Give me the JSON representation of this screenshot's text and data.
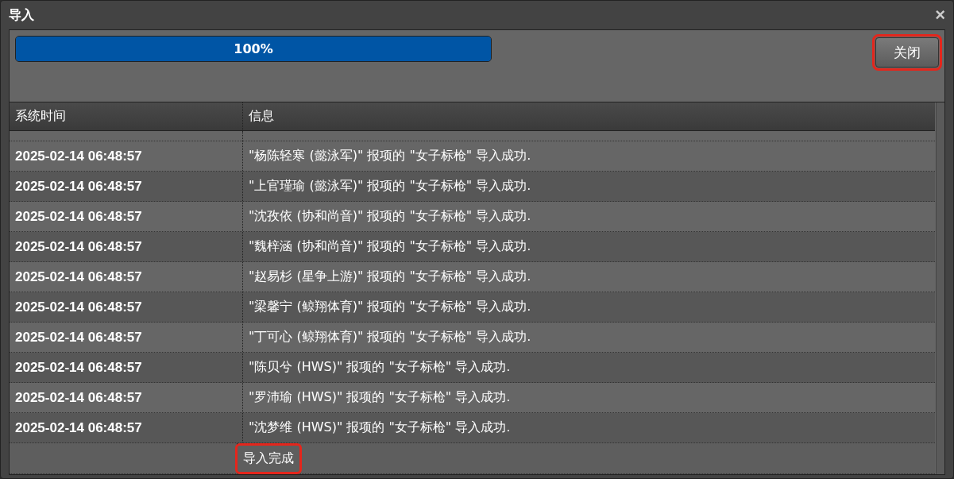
{
  "window": {
    "title": "导入",
    "close_icon": "×"
  },
  "progress": {
    "level": 1,
    "label": "100%"
  },
  "close_button": {
    "label": "关闭",
    "highlighted": true
  },
  "table": {
    "columns": [
      "系统时间",
      "信息"
    ],
    "rows": [
      {
        "time": "2025-02-14 06:48:57",
        "message": "\"杨陈轻寒 (懿泳军)\" 报项的 \"女子标枪\" 导入成功."
      },
      {
        "time": "2025-02-14 06:48:57",
        "message": "\"上官瑾瑜 (懿泳军)\" 报项的 \"女子标枪\" 导入成功."
      },
      {
        "time": "2025-02-14 06:48:57",
        "message": "\"沈孜依 (协和尚音)\" 报项的 \"女子标枪\" 导入成功."
      },
      {
        "time": "2025-02-14 06:48:57",
        "message": "\"魏梓涵 (协和尚音)\" 报项的 \"女子标枪\" 导入成功."
      },
      {
        "time": "2025-02-14 06:48:57",
        "message": "\"赵易杉 (星争上游)\" 报项的 \"女子标枪\" 导入成功."
      },
      {
        "time": "2025-02-14 06:48:57",
        "message": "\"梁馨宁 (鲸翔体育)\" 报项的 \"女子标枪\" 导入成功."
      },
      {
        "time": "2025-02-14 06:48:57",
        "message": "\"丁可心 (鲸翔体育)\" 报项的 \"女子标枪\" 导入成功."
      },
      {
        "time": "2025-02-14 06:48:57",
        "message": "\"陈贝兮 (HWS)\" 报项的 \"女子标枪\" 导入成功."
      },
      {
        "time": "2025-02-14 06:48:57",
        "message": "\"罗沛瑜 (HWS)\" 报项的 \"女子标枪\" 导入成功."
      },
      {
        "time": "2025-02-14 06:48:57",
        "message": "\"沈梦维 (HWS)\" 报项的 \"女子标枪\" 导入成功."
      }
    ],
    "completion": {
      "message": "导入完成",
      "highlighted": true
    }
  }
}
